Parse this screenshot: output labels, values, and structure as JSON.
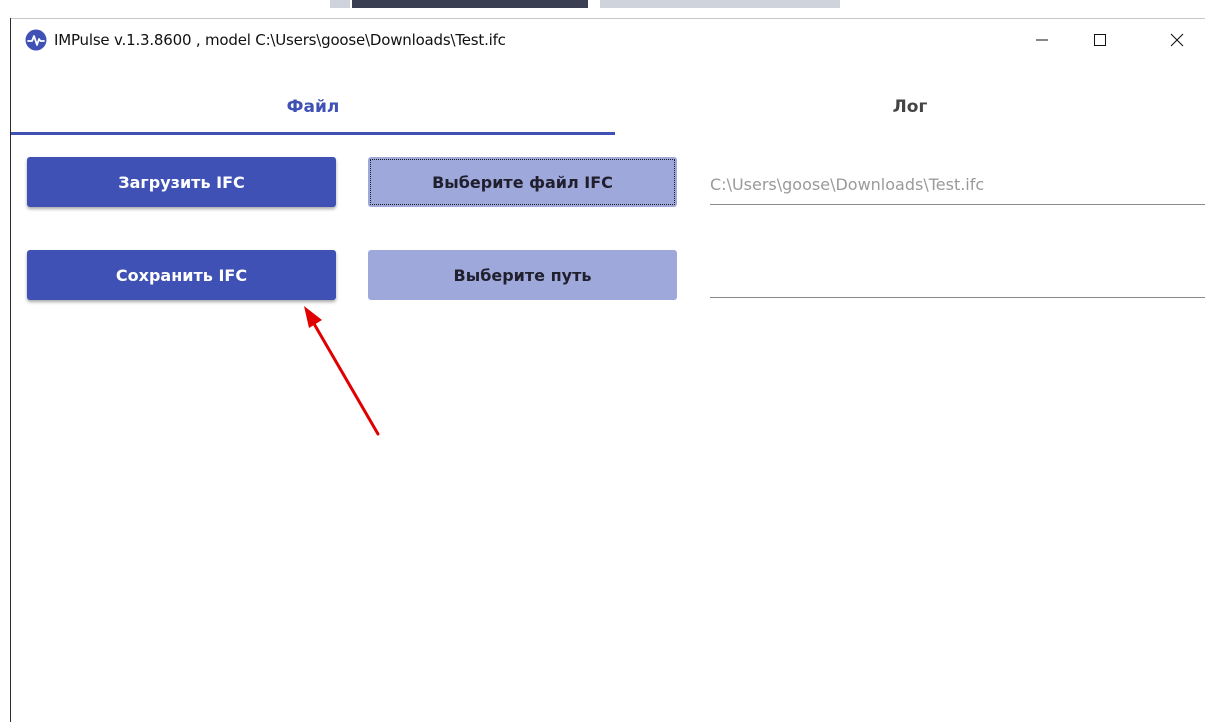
{
  "window": {
    "title": "IMPulse v.1.3.8600 , model C:\\Users\\goose\\Downloads\\Test.ifc",
    "icon": "impulse-heartbeat-icon",
    "controls": [
      "minimize-icon",
      "maximize-icon",
      "close-icon"
    ]
  },
  "tabs": [
    {
      "label": "Файл",
      "active": true
    },
    {
      "label": "Лог",
      "active": false
    }
  ],
  "file_panel": {
    "load_button": "Загрузить IFC",
    "choose_file_button": "Выберите файл IFC",
    "load_path": "C:\\Users\\goose\\Downloads\\Test.ifc",
    "save_button": "Сохранить IFC",
    "choose_path_button": "Выберите путь",
    "save_path": ""
  },
  "colors": {
    "accent": "#3f51b5",
    "secondary": "#9fa8da",
    "annotation_arrow": "#e00000"
  }
}
